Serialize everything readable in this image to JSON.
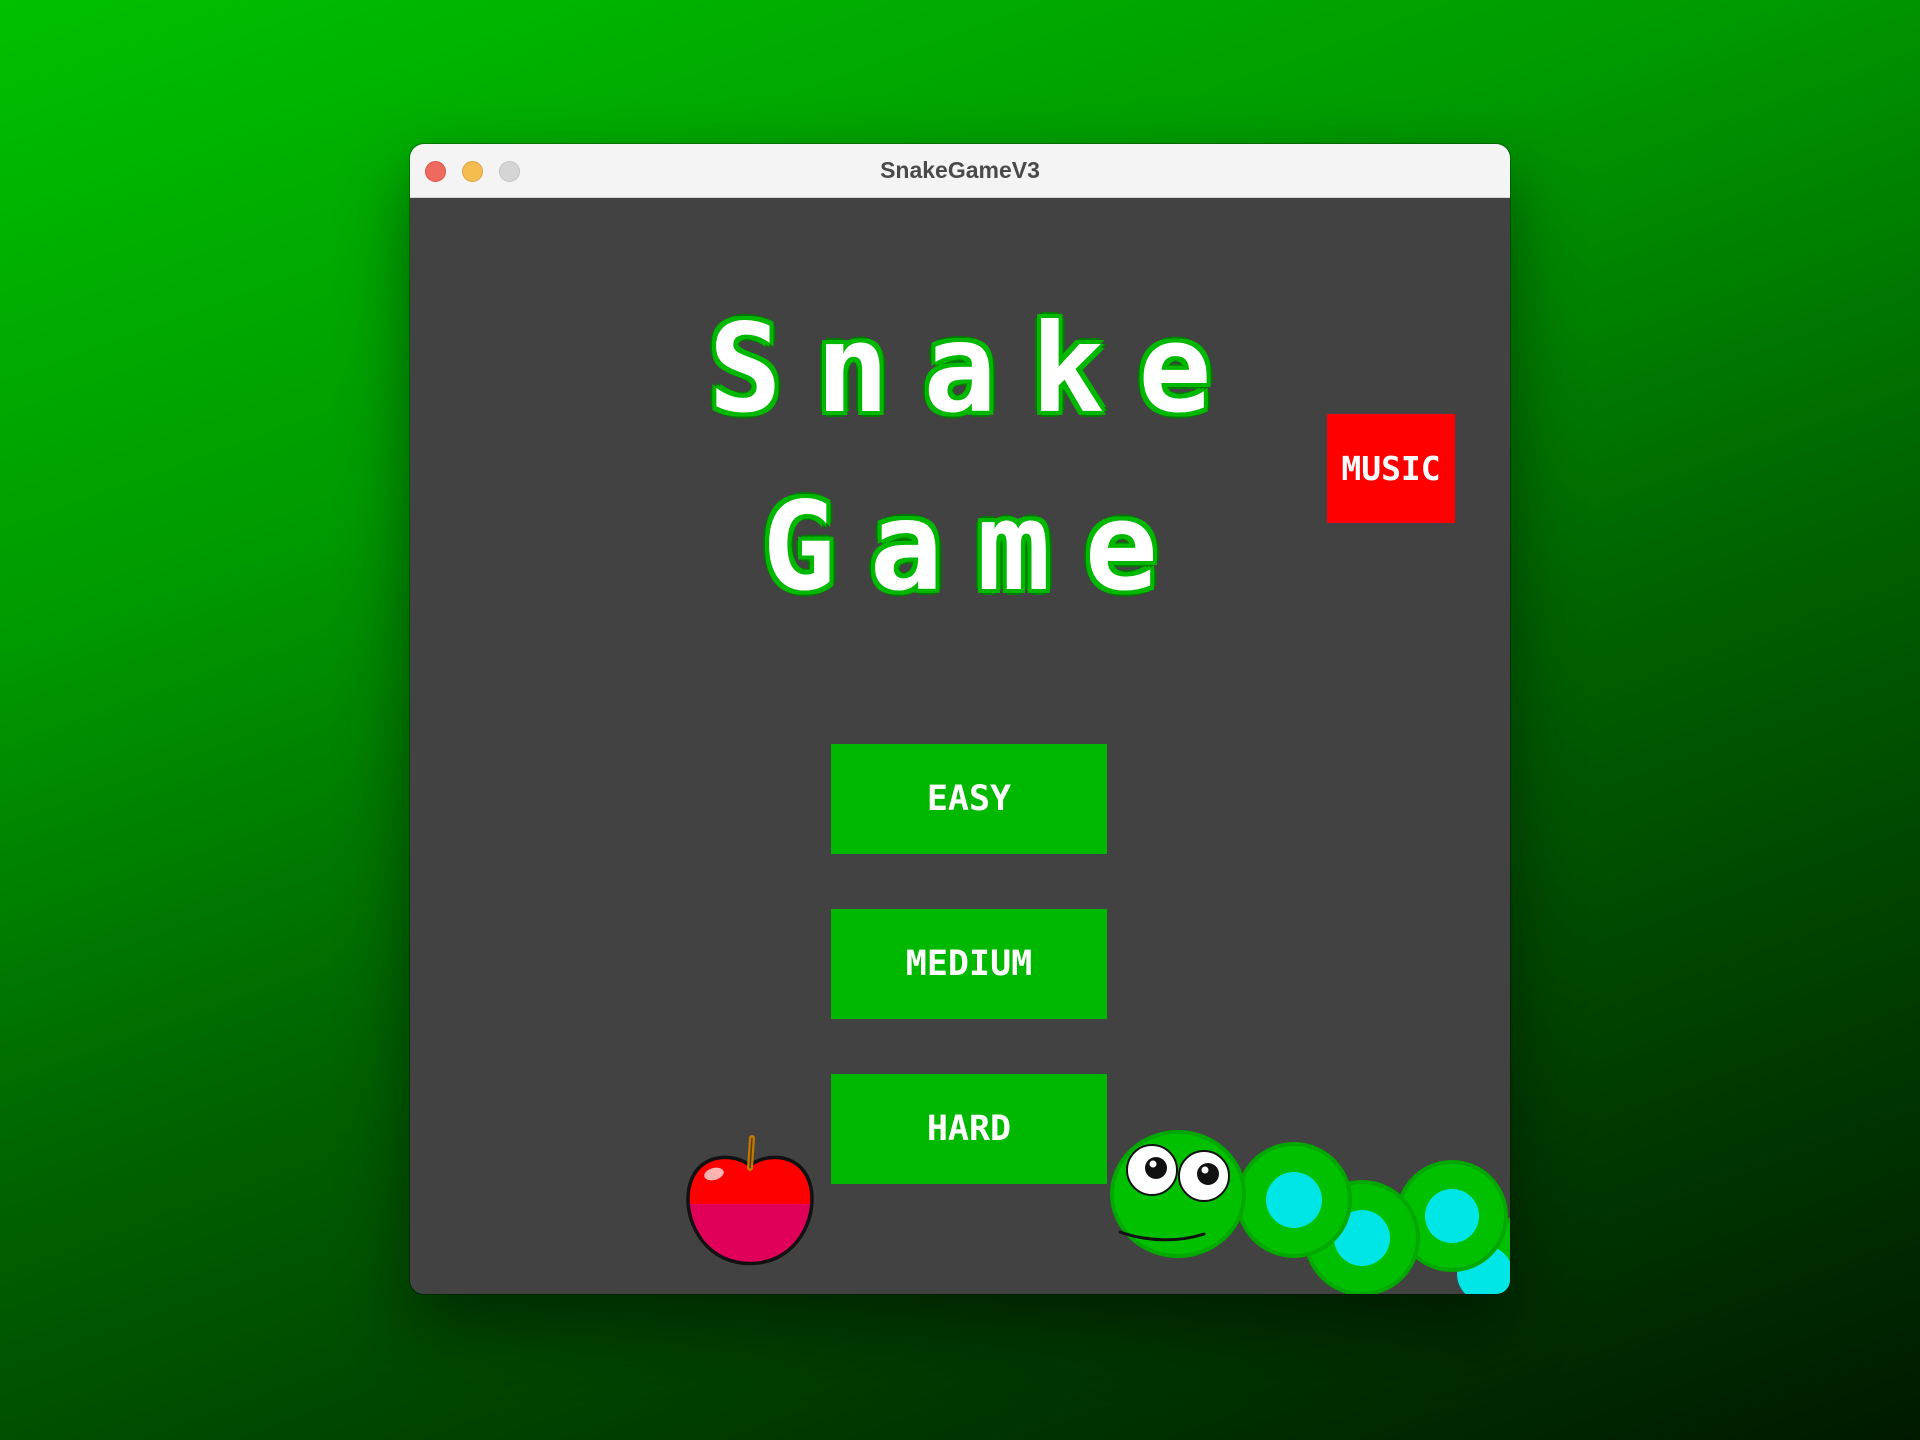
{
  "window": {
    "title": "SnakeGameV3"
  },
  "game": {
    "title_line_1": "Snake",
    "title_line_2": "Game",
    "music_label": "MUSIC",
    "difficulty_buttons": [
      {
        "label": "EASY"
      },
      {
        "label": "MEDIUM"
      },
      {
        "label": "HARD"
      }
    ]
  },
  "colors": {
    "desktop_bg_top": "#00c000",
    "desktop_bg_bottom": "#001a00",
    "game_bg": "#424242",
    "button_green": "#00b800",
    "music_red": "#ff0000",
    "title_fill": "#ffffff",
    "title_outline": "#00b800",
    "snake_body": "#00c000",
    "snake_spot": "#00e5e5",
    "apple_red": "#ff0000"
  },
  "icons": {
    "apple": "apple-icon",
    "snake": "snake-mascot-icon"
  }
}
